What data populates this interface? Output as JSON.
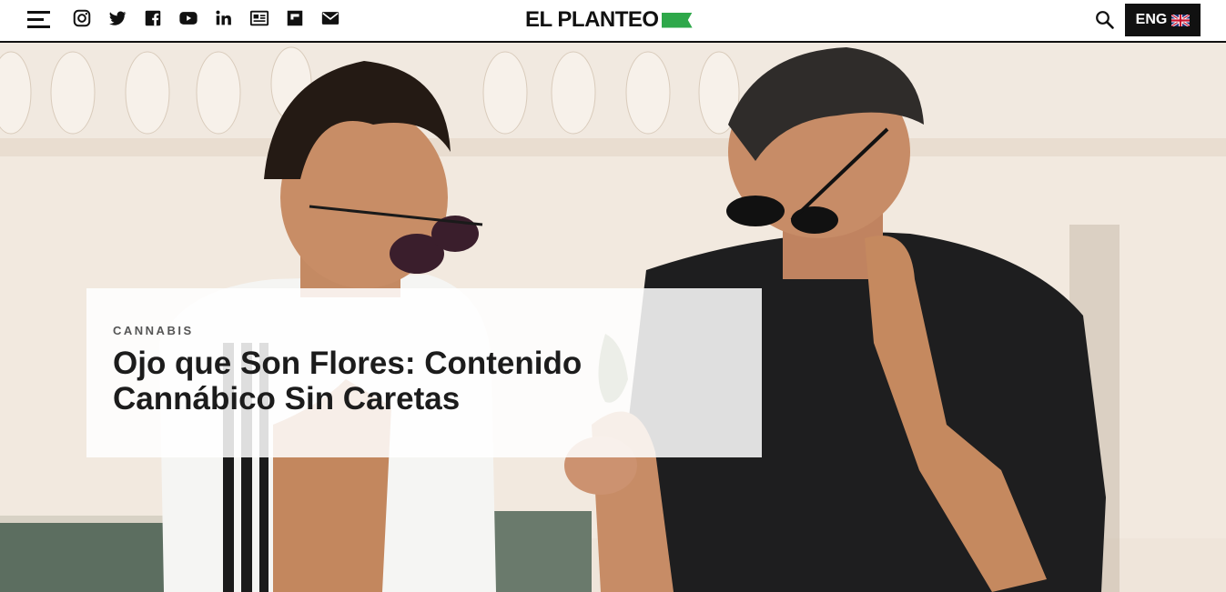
{
  "header": {
    "menu_icon": "hamburger-menu-icon",
    "social_icons": [
      "instagram-icon",
      "twitter-icon",
      "facebook-icon",
      "youtube-icon",
      "linkedin-icon",
      "newspaper-icon",
      "flipboard-icon",
      "mail-icon"
    ],
    "logo_text": "EL PLANTEO",
    "logo_flag_color": "#2ea84a",
    "search_icon": "search-icon",
    "language_label": "ENG",
    "language_flag_icon": "uk-flag-icon"
  },
  "hero": {
    "category": "CANNABIS",
    "headline": "Ojo que Son Flores: Contenido Cannábico Sin Caretas"
  }
}
